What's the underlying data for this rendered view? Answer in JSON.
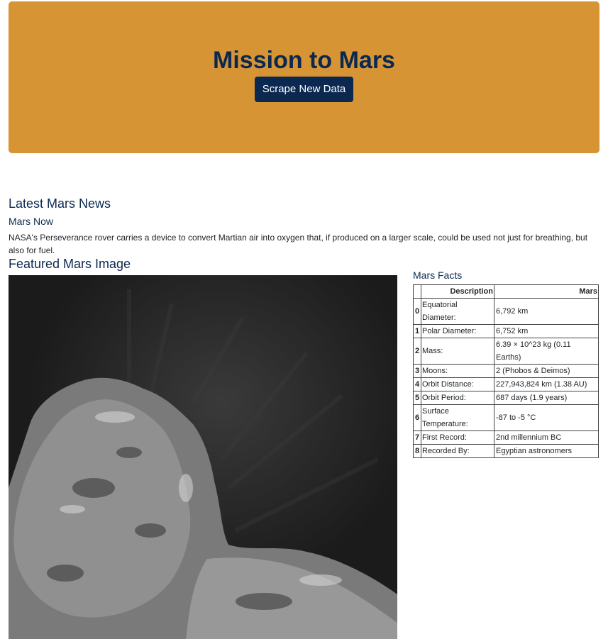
{
  "jumbotron": {
    "title": "Mission to Mars",
    "button_label": "Scrape New Data",
    "background": "#d69435",
    "accent": "#0b2850"
  },
  "news": {
    "heading": "Latest Mars News",
    "title": "Mars Now",
    "paragraph": "NASA's Perseverance rover carries a device to convert Martian air into oxygen that, if produced on a larger scale, could be used not just for breathing, but also for fuel."
  },
  "featured": {
    "heading": "Featured Mars Image",
    "image_icon": "comet-photo-icon"
  },
  "facts": {
    "heading": "Mars Facts",
    "columns": [
      "",
      "Description",
      "Mars"
    ],
    "rows": [
      {
        "index": "0",
        "description": "Equatorial Diameter:",
        "value": "6,792 km"
      },
      {
        "index": "1",
        "description": "Polar Diameter:",
        "value": "6,752 km"
      },
      {
        "index": "2",
        "description": "Mass:",
        "value": "6.39 × 10^23 kg (0.11 Earths)"
      },
      {
        "index": "3",
        "description": "Moons:",
        "value": "2 (Phobos & Deimos)"
      },
      {
        "index": "4",
        "description": "Orbit Distance:",
        "value": "227,943,824 km (1.38 AU)"
      },
      {
        "index": "5",
        "description": "Orbit Period:",
        "value": "687 days (1.9 years)"
      },
      {
        "index": "6",
        "description": "Surface Temperature:",
        "value": "-87 to -5 °C"
      },
      {
        "index": "7",
        "description": "First Record:",
        "value": "2nd millennium BC"
      },
      {
        "index": "8",
        "description": "Recorded By:",
        "value": "Egyptian astronomers"
      }
    ]
  }
}
